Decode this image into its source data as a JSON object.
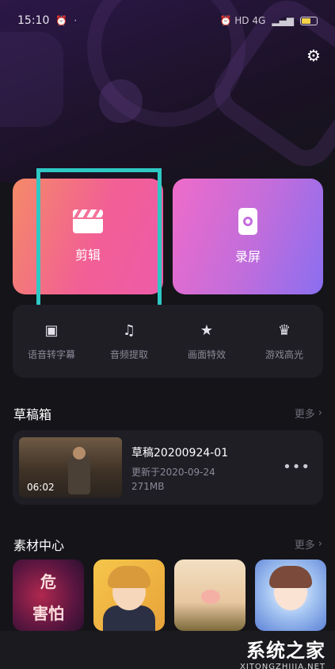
{
  "status_bar": {
    "time": "15:10",
    "right_indicators": "⏰ HD 4G",
    "battery_color": "#f3d34a"
  },
  "settings": {
    "icon": "gear-icon"
  },
  "main_cards": {
    "edit_label": "剪辑",
    "record_label": "录屏"
  },
  "tools": [
    {
      "label": "语音转字幕",
      "icon": "subtitle-icon"
    },
    {
      "label": "音频提取",
      "icon": "audio-extract-icon"
    },
    {
      "label": "画面特效",
      "icon": "effects-icon"
    },
    {
      "label": "游戏高光",
      "icon": "trophy-icon"
    }
  ],
  "drafts": {
    "title": "草稿箱",
    "more": "更多",
    "item": {
      "duration": "06:02",
      "name": "草稿20200924-01",
      "updated": "更新于2020-09-24",
      "size": "271MB",
      "menu": "•••"
    }
  },
  "materials": {
    "title": "素材中心",
    "more": "更多",
    "tile1_text": "危",
    "tile1_text2": "害怕"
  },
  "watermark": {
    "title": "系统之家",
    "url": "XITONGZHIJIA.NET"
  },
  "colors": {
    "highlight": "#2ec8c4",
    "edit_gradient_start": "#f48a68",
    "record_gradient_end": "#8a6ef0",
    "background": "#151419"
  }
}
